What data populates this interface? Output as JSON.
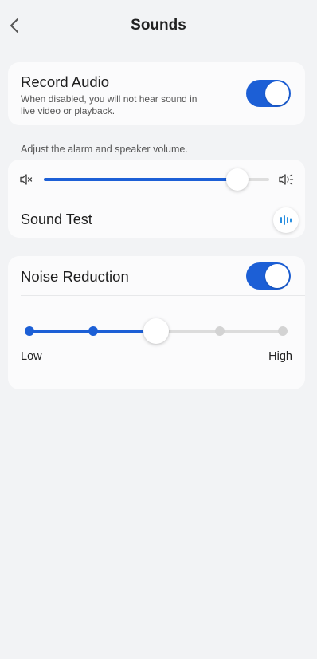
{
  "header": {
    "title": "Sounds",
    "back_icon": "chevron-left-icon"
  },
  "record_audio": {
    "title": "Record Audio",
    "description": "When disabled, you will not hear sound in live video or playback.",
    "enabled": true
  },
  "volume": {
    "hint": "Adjust the alarm and speaker volume.",
    "level": 0.86,
    "min_icon": "speaker-mute-icon",
    "max_icon": "speaker-loud-icon"
  },
  "sound_test": {
    "label": "Sound Test",
    "icon": "sound-wave-icon"
  },
  "noise_reduction": {
    "title": "Noise Reduction",
    "enabled": true,
    "levels": 5,
    "selected_level": 3,
    "low_label": "Low",
    "high_label": "High"
  },
  "colors": {
    "accent": "#1c5fd6",
    "background": "#f2f3f5",
    "card": "#fbfbfc",
    "sound_wave": "#2a8fe0"
  }
}
